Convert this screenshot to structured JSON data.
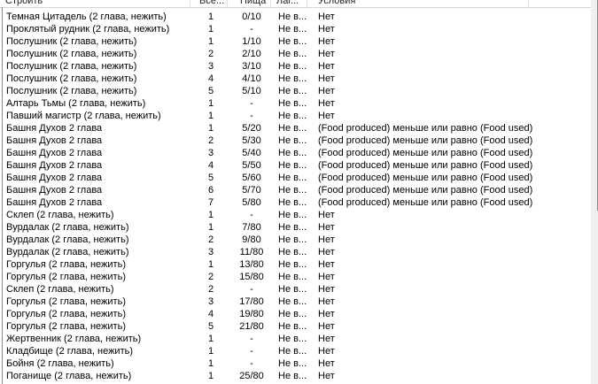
{
  "columns": [
    "Строить",
    "Все...",
    "Пища",
    "Лаг...",
    "Условия"
  ],
  "rows": [
    [
      "Темная Цитадель (2 глава, нежить)",
      "1",
      "0/10",
      "Не в...",
      "Нет"
    ],
    [
      "Проклятый рудник (2 глава, нежить)",
      "1",
      "-",
      "Не в...",
      "Нет"
    ],
    [
      "Послушник (2 глава, нежить)",
      "1",
      "1/10",
      "Не в...",
      "Нет"
    ],
    [
      "Послушник (2 глава, нежить)",
      "2",
      "2/10",
      "Не в...",
      "Нет"
    ],
    [
      "Послушник (2 глава, нежить)",
      "3",
      "3/10",
      "Не в...",
      "Нет"
    ],
    [
      "Послушник (2 глава, нежить)",
      "4",
      "4/10",
      "Не в...",
      "Нет"
    ],
    [
      "Послушник (2 глава, нежить)",
      "5",
      "5/10",
      "Не в...",
      "Нет"
    ],
    [
      "Алтарь Тьмы (2 глава, нежить)",
      "1",
      "-",
      "Не в...",
      "Нет"
    ],
    [
      "Павший магистр (2 глава, нежить)",
      "1",
      "-",
      "Не в...",
      "Нет"
    ],
    [
      "Башня Духов 2 глава",
      "1",
      "5/20",
      "Не в...",
      "(Food produced) меньше или равно (Food used)"
    ],
    [
      "Башня Духов 2 глава",
      "2",
      "5/30",
      "Не в...",
      "(Food produced) меньше или равно (Food used)"
    ],
    [
      "Башня Духов 2 глава",
      "3",
      "5/40",
      "Не в...",
      "(Food produced) меньше или равно (Food used)"
    ],
    [
      "Башня Духов 2 глава",
      "4",
      "5/50",
      "Не в...",
      "(Food produced) меньше или равно (Food used)"
    ],
    [
      "Башня Духов 2 глава",
      "5",
      "5/60",
      "Не в...",
      "(Food produced) меньше или равно (Food used)"
    ],
    [
      "Башня Духов 2 глава",
      "6",
      "5/70",
      "Не в...",
      "(Food produced) меньше или равно (Food used)"
    ],
    [
      "Башня Духов 2 глава",
      "7",
      "5/80",
      "Не в...",
      "(Food produced) меньше или равно (Food used)"
    ],
    [
      "Склеп (2 глава, нежить)",
      "1",
      "-",
      "Не в...",
      "Нет"
    ],
    [
      "Вурдалак (2 глава, нежить)",
      "1",
      "7/80",
      "Не в...",
      "Нет"
    ],
    [
      "Вурдалак (2 глава, нежить)",
      "2",
      "9/80",
      "Не в...",
      "Нет"
    ],
    [
      "Вурдалак (2 глава, нежить)",
      "3",
      "11/80",
      "Не в...",
      "Нет"
    ],
    [
      "Горгулья (2 глава, нежить)",
      "1",
      "13/80",
      "Не в...",
      "Нет"
    ],
    [
      "Горгулья (2 глава, нежить)",
      "2",
      "15/80",
      "Не в...",
      "Нет"
    ],
    [
      "Склеп (2 глава, нежить)",
      "2",
      "-",
      "Не в...",
      "Нет"
    ],
    [
      "Горгулья (2 глава, нежить)",
      "3",
      "17/80",
      "Не в...",
      "Нет"
    ],
    [
      "Горгулья (2 глава, нежить)",
      "4",
      "19/80",
      "Не в...",
      "Нет"
    ],
    [
      "Горгулья (2 глава, нежить)",
      "5",
      "21/80",
      "Не в...",
      "Нет"
    ],
    [
      "Жертвенник (2 глава, нежить)",
      "1",
      "-",
      "Не в...",
      "Нет"
    ],
    [
      "Кладбище (2 глава, нежить)",
      "1",
      "-",
      "Не в...",
      "Нет"
    ],
    [
      "Бойня (2 глава, нежить)",
      "1",
      "-",
      "Не в...",
      "Нет"
    ],
    [
      "Поганище (2 глава, нежить)",
      "1",
      "25/80",
      "Не в...",
      "Нет"
    ]
  ]
}
